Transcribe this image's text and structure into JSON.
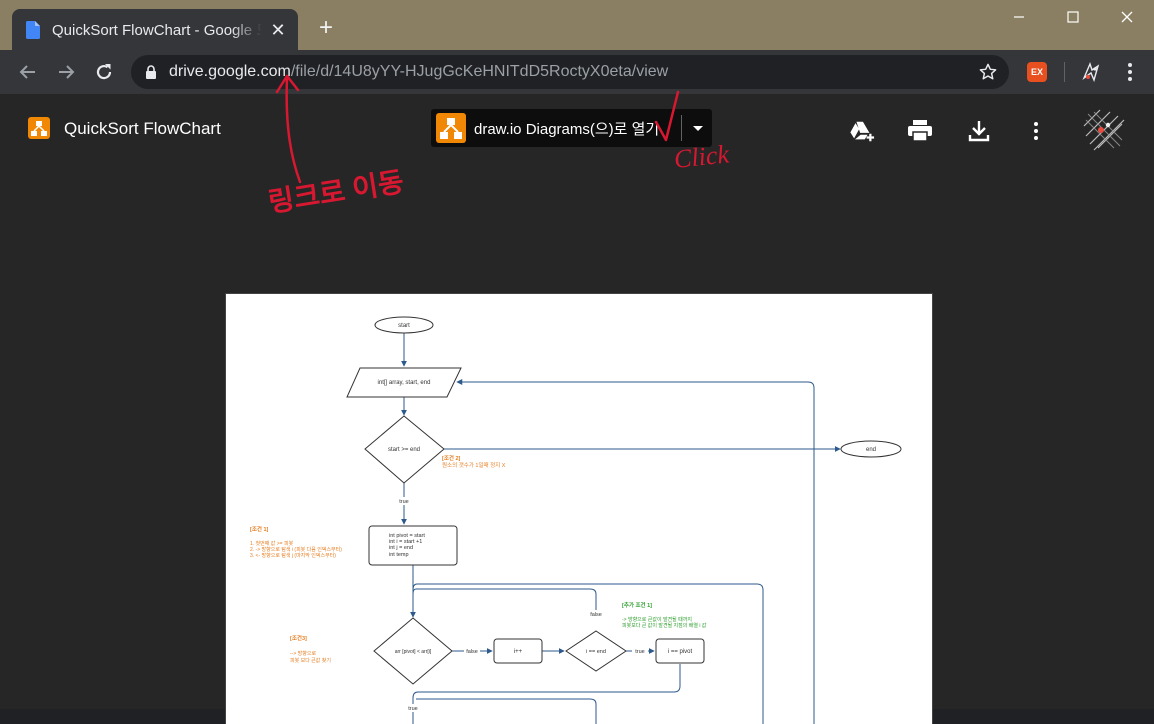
{
  "browser": {
    "tab_title": "QuickSort FlowChart - Google 드라이브",
    "tab_close_glyph": "✕",
    "new_tab_glyph": "+",
    "url_host": "drive.google.com",
    "url_path": "/file/d/14U8yYY-HJugGcKeHNITdD5RoctyX0eta/view",
    "ext_label": "EX"
  },
  "viewer": {
    "file_name": "QuickSort FlowChart",
    "open_with_label": "draw.io Diagrams(으)로 열기"
  },
  "flowchart": {
    "start": "start",
    "input": "int[] array, start, end",
    "decision1": "start >=  end",
    "end": "end",
    "label_true": "true",
    "note_cond2_title": "[조건 2]",
    "note_cond2_body": "원소의 갯수가 1일때 정지 X",
    "note_cond1_title": "[조건 1]",
    "note_cond1_line1": "1. 첫번째 값 >= 피봇",
    "note_cond1_line2": "2. -> 방향으로 탐색 i (피봇 다음 인덱스부터)",
    "note_cond1_line3": "3. <- 방향으로 탐색 j (마지막 인덱스부터)",
    "init_line1": "int pivot = start",
    "init_line2": "int i = start +1",
    "init_line3": "int j = end",
    "init_line4": "int temp",
    "label_false": "false",
    "note_extra_title": "[추가 조건 1]",
    "note_extra_line1": "-> 방향으로 큰값이 발견될 때까지",
    "note_extra_line2": "피봇보다 큰 값이 발견될 지점의 배열 i 값",
    "note_cond3_title": "[조건3]",
    "note_cond3_line1": "--> 방향으로",
    "note_cond3_line2": "피봇 보다 큰값 찾기",
    "decision2": "arr [pivot] < arr[i]",
    "step_inc": "i++",
    "decision3": "i == end",
    "step_pivot": "i == pivot"
  },
  "annotations": {
    "link_note": "링크로 이동",
    "click_note": "Click"
  }
}
